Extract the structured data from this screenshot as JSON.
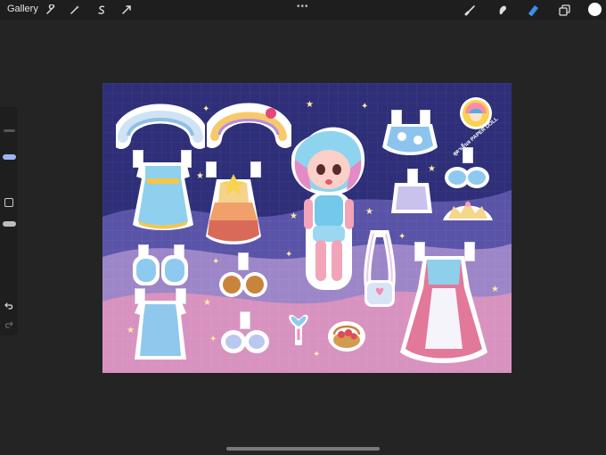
{
  "topbar": {
    "gallery_label": "Gallery",
    "menu_dots": "•••",
    "left_tools": [
      "wrench-icon",
      "magic-wand-icon",
      "selection-icon",
      "transform-icon"
    ],
    "right_tools": [
      "brush-icon",
      "smudge-icon",
      "eraser-icon",
      "layers-icon"
    ],
    "active_tool": "eraser-icon",
    "active_color": "#ffffff"
  },
  "sidebar": {
    "controls": [
      "brush-size-slider",
      "modify-button",
      "opacity-slider",
      "undo-button",
      "redo-button"
    ]
  },
  "canvas": {
    "logo_text": "สุดาเย็นจ PAPER DOLL",
    "colors": {
      "sky": "#2e2f78",
      "hill_front": "#d892c0",
      "hill_mid": "#9d86c8",
      "hill_back": "#5a54a8"
    }
  }
}
